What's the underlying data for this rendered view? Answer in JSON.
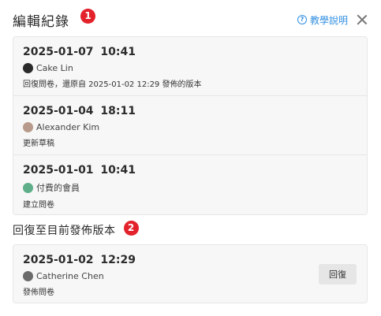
{
  "header": {
    "title": "編輯紀錄",
    "step_badge": "1",
    "help_label": "教學說明",
    "help_icon": "?"
  },
  "history": [
    {
      "time": "2025-01-07  10:41",
      "user": "Cake Lin",
      "action": "回復問卷，還原自 2025-01-02  12:29 發佈的版本",
      "avatar_color": "#2a2a2a"
    },
    {
      "time": "2025-01-04  18:11",
      "user": "Alexander Kim",
      "action": "更新草稿",
      "avatar_color": "#b89a8c"
    },
    {
      "time": "2025-01-01  10:41",
      "user": "付費的會員",
      "action": "建立問卷",
      "avatar_color": "#5fae8a"
    }
  ],
  "restore_section": {
    "title": "回復至目前發佈版本",
    "step_badge": "2",
    "entry": {
      "time": "2025-01-02  12:29",
      "user": "Catherine Chen",
      "action": "發佈問卷",
      "avatar_color": "#6b6b6b"
    },
    "restore_button_label": "回復"
  },
  "colors": {
    "badge": "#e3222b",
    "link": "#2f8ee0",
    "card_bg": "#f7f7f7",
    "border": "#e6e6e6"
  }
}
